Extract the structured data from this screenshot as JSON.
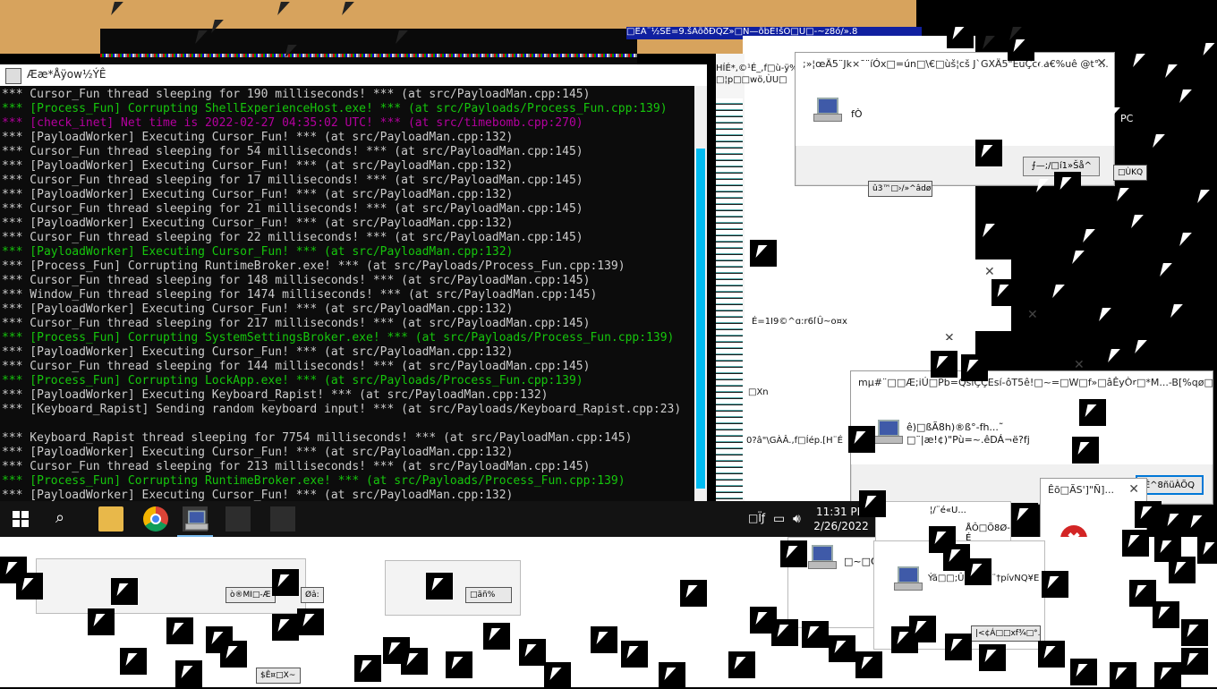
{
  "console": {
    "title": "Ææ*Åÿow½ÝÊ",
    "lines": [
      {
        "text": "*** Cursor_Fun thread sleeping for 190 milliseconds! *** (at src/PayloadMan.cpp:145)",
        "color": "gray"
      },
      {
        "text": "*** [Process_Fun] Corrupting ShellExperienceHost.exe! *** (at src/Payloads/Process_Fun.cpp:139)",
        "color": "green"
      },
      {
        "text": "*** [check_inet] Net time is 2022-02-27 04:35:02 UTC! *** (at src/timebomb.cpp:270)",
        "color": "magenta"
      },
      {
        "text": "*** [PayloadWorker] Executing Cursor_Fun! *** (at src/PayloadMan.cpp:132)",
        "color": "gray"
      },
      {
        "text": "*** Cursor_Fun thread sleeping for 54 milliseconds! *** (at src/PayloadMan.cpp:145)",
        "color": "gray"
      },
      {
        "text": "*** [PayloadWorker] Executing Cursor_Fun! *** (at src/PayloadMan.cpp:132)",
        "color": "gray"
      },
      {
        "text": "*** Cursor_Fun thread sleeping for 17 milliseconds! *** (at src/PayloadMan.cpp:145)",
        "color": "gray"
      },
      {
        "text": "*** [PayloadWorker] Executing Cursor_Fun! *** (at src/PayloadMan.cpp:132)",
        "color": "gray"
      },
      {
        "text": "*** Cursor_Fun thread sleeping for 21 milliseconds! *** (at src/PayloadMan.cpp:145)",
        "color": "gray"
      },
      {
        "text": "*** [PayloadWorker] Executing Cursor_Fun! *** (at src/PayloadMan.cpp:132)",
        "color": "gray"
      },
      {
        "text": "*** Cursor_Fun thread sleeping for 22 milliseconds! *** (at src/PayloadMan.cpp:145)",
        "color": "gray"
      },
      {
        "text": "*** [PayloadWorker] Executing Cursor_Fun! *** (at src/PayloadMan.cpp:132)",
        "color": "green"
      },
      {
        "text": "*** [Process_Fun] Corrupting RuntimeBroker.exe! *** (at src/Payloads/Process_Fun.cpp:139)",
        "color": "gray"
      },
      {
        "text": "*** Cursor_Fun thread sleeping for 148 milliseconds! *** (at src/PayloadMan.cpp:145)",
        "color": "gray"
      },
      {
        "text": "*** Window_Fun thread sleeping for 1474 milliseconds! *** (at src/PayloadMan.cpp:145)",
        "color": "gray"
      },
      {
        "text": "*** [PayloadWorker] Executing Cursor_Fun! *** (at src/PayloadMan.cpp:132)",
        "color": "gray"
      },
      {
        "text": "*** Cursor_Fun thread sleeping for 217 milliseconds! *** (at src/PayloadMan.cpp:145)",
        "color": "gray"
      },
      {
        "text": "*** [Process_Fun] Corrupting SystemSettingsBroker.exe! *** (at src/Payloads/Process_Fun.cpp:139)",
        "color": "green"
      },
      {
        "text": "*** [PayloadWorker] Executing Cursor_Fun! *** (at src/PayloadMan.cpp:132)",
        "color": "gray"
      },
      {
        "text": "*** Cursor_Fun thread sleeping for 144 milliseconds! *** (at src/PayloadMan.cpp:145)",
        "color": "gray"
      },
      {
        "text": "*** [Process_Fun] Corrupting LockApp.exe! *** (at src/Payloads/Process_Fun.cpp:139)",
        "color": "green"
      },
      {
        "text": "*** [PayloadWorker] Executing Keyboard_Rapist! *** (at src/PayloadMan.cpp:132)",
        "color": "gray"
      },
      {
        "text": "*** [Keyboard_Rapist] Sending random keyboard input! *** (at src/Payloads/Keyboard_Rapist.cpp:23)",
        "color": "gray"
      },
      {
        "text": "",
        "color": "gray"
      },
      {
        "text": "*** Keyboard_Rapist thread sleeping for 7754 milliseconds! *** (at src/PayloadMan.cpp:145)",
        "color": "gray"
      },
      {
        "text": "*** [PayloadWorker] Executing Cursor_Fun! *** (at src/PayloadMan.cpp:132)",
        "color": "gray"
      },
      {
        "text": "*** Cursor_Fun thread sleeping for 213 milliseconds! *** (at src/PayloadMan.cpp:145)",
        "color": "gray"
      },
      {
        "text": "*** [Process_Fun] Corrupting RuntimeBroker.exe! *** (at src/Payloads/Process_Fun.cpp:139)",
        "color": "green"
      },
      {
        "text": "*** [PayloadWorker] Executing Cursor_Fun! *** (at src/PayloadMan.cpp:132)",
        "color": "gray"
      }
    ]
  },
  "colors": {
    "console_bg": "#0c0c0c",
    "gray": "#cccccc",
    "green": "#16c60c",
    "magenta": "#b4009e",
    "desktop": "#d7a35d",
    "scroll_accent": "#00bcf2",
    "error_red": "#d32525"
  },
  "taskbar": {
    "time": "11:31 PM",
    "date": "2/26/2022",
    "apps": [
      "file-explorer-icon",
      "chrome-icon",
      "app-icon",
      "app-icon",
      "app-icon"
    ]
  },
  "dialogs": {
    "top": {
      "title": ";»¦œÄ5¨Jk×¯¨íÓx□=ún□\\€□ùš¦cš J`GXÄ5\"EuÇceâ€%uê @t°...",
      "text": "fÒ",
      "button": "⨍—;/□í1»Šå^"
    },
    "mid": {
      "title": "mµ#¨□□Æ;iÚ□Pb=QsìÇÇEsí-ôT5ê!□~=□W□f»□âÊyÒr□*M...-B[%qø□...",
      "text1": "ê)□ßÃ8h)®ß°-fh...˜",
      "text2": "□¨|æ!¢)\"Pù=~.êDÁ¬ë?fj",
      "button": "Ê^8ñüÀÕQ"
    },
    "error": {
      "title": "Êõ□ÃS']\"Ñ]...",
      "icon_glyph": "✖"
    },
    "bottom_right": {
      "text": "Ýã□□;Ûš[Z.ú?¨†pívNQ¥E",
      "button": "|<¢Á□□xf¾□°."
    },
    "bottom_mid": {
      "text": "□~□O"
    },
    "misc": {
      "label1": "û3™□›/»^âdø",
      "label2": "ò®MI□-Æ",
      "label3": "Øâ:",
      "label4": "□ãñ%",
      "label5": "$Ê¤□X~",
      "title_glitch": "□ÊÁ¨½SÊ=9.šÂõðÐQZ»□N—õbÉ!šÓ□U□-~z8ó/».8",
      "side1": "HÍÉ*,©¹É_,f□ù-ÿ%",
      "side2": "□¦p□□wö,ÙU□",
      "side3": "É=1I9©^q;r6[Û~o¤x",
      "side4": "0?â\"\\GÀÂ.,f□Íép.[H¨É",
      "side5": "□Xn",
      "pc_label": "PC",
      "right_btn": "□ÙKQ",
      "tray_text": "□Ïƒ",
      "mini_title": "¦/¨é«U...",
      "mini_label": "ÅÔ□Ö8Ø-É"
    }
  }
}
